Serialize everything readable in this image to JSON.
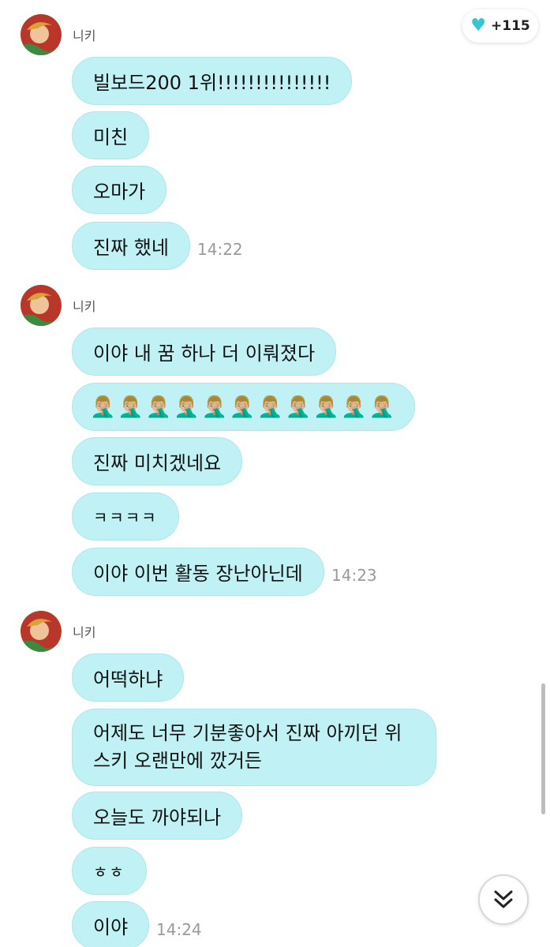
{
  "like_badge": {
    "icon": "heart-icon",
    "count": "+115",
    "color": "#34c6d3"
  },
  "groups": [
    {
      "sender": "니키",
      "messages": [
        {
          "text": "빌보드200 1위!!!!!!!!!!!!!!!"
        },
        {
          "text": "미친"
        },
        {
          "text": "오마가"
        },
        {
          "text": "진짜 했네",
          "time": "14:22"
        }
      ]
    },
    {
      "sender": "니키",
      "messages": [
        {
          "text": "이야 내 꿈 하나 더 이뤄졌다"
        },
        {
          "text": "🤦🏼‍♂️🤦🏼‍♂️🤦🏼‍♂️🤦🏼‍♂️🤦🏼‍♂️🤦🏼‍♂️🤦🏼‍♂️🤦🏼‍♂️🤦🏼‍♂️🤦🏼‍♂️🤦🏼‍♂️"
        },
        {
          "text": "진짜 미치겠네요"
        },
        {
          "text": "ㅋㅋㅋㅋ"
        },
        {
          "text": "이야 이번 활동 장난아닌데",
          "time": "14:23"
        }
      ]
    },
    {
      "sender": "니키",
      "messages": [
        {
          "text": "어떡하냐"
        },
        {
          "text": "어제도 너무 기분좋아서 진짜 아끼던 위스키 오랜만에 깠거든"
        },
        {
          "text": "오늘도 까야되나"
        },
        {
          "text": "ㅎㅎ"
        },
        {
          "text": "이야",
          "time": "14:24"
        }
      ]
    }
  ],
  "scroll_button": {
    "icon": "double-chevron-down-icon"
  },
  "bubble_color": "#bff1f5"
}
